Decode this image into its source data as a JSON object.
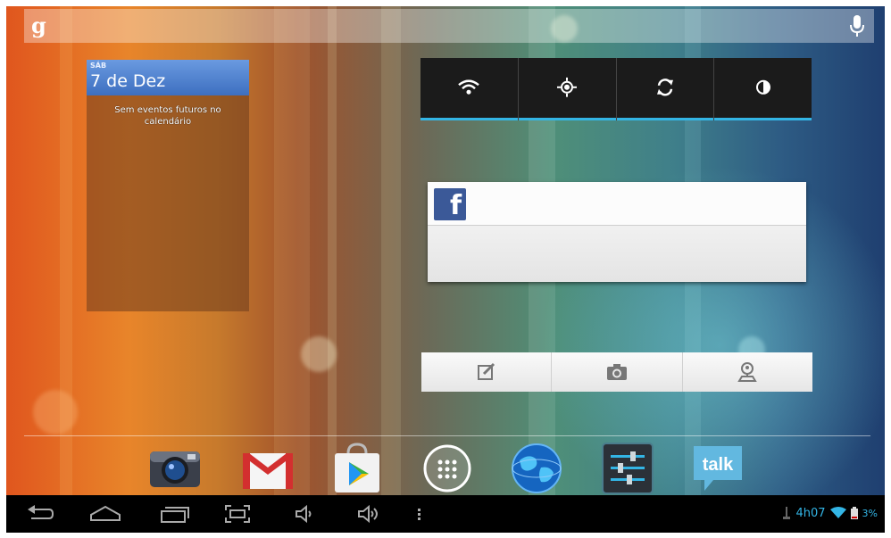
{
  "search": {
    "logo": "g",
    "logo_icon": "google-g-icon",
    "mic_icon": "mic-icon"
  },
  "calendar_widget": {
    "day_of_week": "SÁB",
    "date": "7 de Dez",
    "empty_message": "Sem eventos futuros no calendário"
  },
  "quick_settings": [
    {
      "name": "wifi-toggle",
      "icon": "wifi-icon"
    },
    {
      "name": "gps-toggle",
      "icon": "gps-icon"
    },
    {
      "name": "sync-toggle",
      "icon": "sync-icon"
    },
    {
      "name": "brightness-toggle",
      "icon": "brightness-icon"
    }
  ],
  "facebook_widget": {
    "logo": "f",
    "icon": "facebook-icon"
  },
  "actions_widget": [
    {
      "name": "compose-button",
      "icon": "edit-icon"
    },
    {
      "name": "camera-button",
      "icon": "camera-icon"
    },
    {
      "name": "checkin-button",
      "icon": "location-person-icon"
    }
  ],
  "dock": [
    {
      "name": "camera-app",
      "icon": "camera-app-icon"
    },
    {
      "name": "gmail-app",
      "icon": "gmail-icon"
    },
    {
      "name": "play-store-app",
      "icon": "play-store-icon"
    },
    {
      "name": "all-apps",
      "icon": "apps-grid-icon"
    },
    {
      "name": "browser-app",
      "icon": "globe-icon"
    },
    {
      "name": "settings-app",
      "icon": "settings-sliders-icon"
    },
    {
      "name": "talk-app",
      "icon": "talk-icon",
      "label": "talk"
    }
  ],
  "navbar": {
    "buttons": [
      "back-icon",
      "home-icon",
      "recents-icon",
      "screenshot-icon",
      "volume-down-icon",
      "volume-up-icon",
      "menu-icon"
    ],
    "clock": "4h07",
    "battery": "3%"
  },
  "colors": {
    "accent": "#33b5e5",
    "facebook": "#3b5998",
    "calendar_header": "#4a7ed0"
  }
}
